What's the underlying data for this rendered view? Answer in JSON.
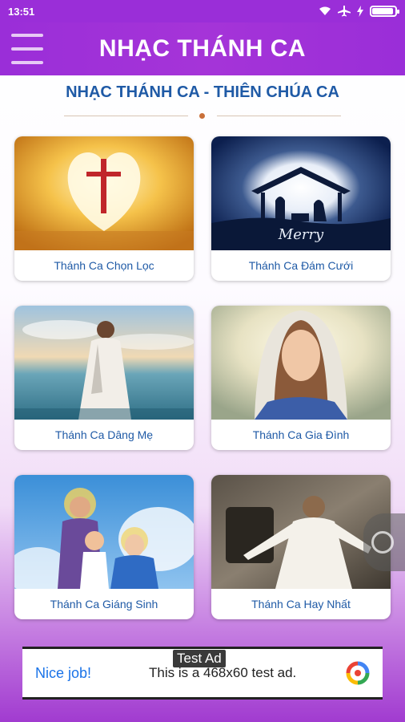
{
  "status_bar": {
    "time": "13:51"
  },
  "app_bar": {
    "title": "NHẠC THÁNH CA"
  },
  "section": {
    "title": "NHẠC THÁNH CA - THIÊN CHÚA CA"
  },
  "cards": [
    {
      "label": "Thánh Ca Chọn Lọc",
      "image": "heart-cross-image"
    },
    {
      "label": "Thánh Ca Đám Cưới",
      "image": "nativity-merry-image"
    },
    {
      "label": "Thánh Ca Dâng Mẹ",
      "image": "jesus-sea-image"
    },
    {
      "label": "Thánh Ca Gia Đình",
      "image": "mary-portrait-image"
    },
    {
      "label": "Thánh Ca Giáng Sinh",
      "image": "holy-family-image"
    },
    {
      "label": "Thánh Ca Hay Nhất",
      "image": "risen-jesus-image"
    }
  ],
  "ad": {
    "tag": "Test Ad",
    "headline": "Nice job!",
    "text": "This is a 468x60 test ad."
  },
  "colors": {
    "appbar": "#9a2ed8",
    "label": "#1f5aa6",
    "accent": "#c9703a"
  }
}
